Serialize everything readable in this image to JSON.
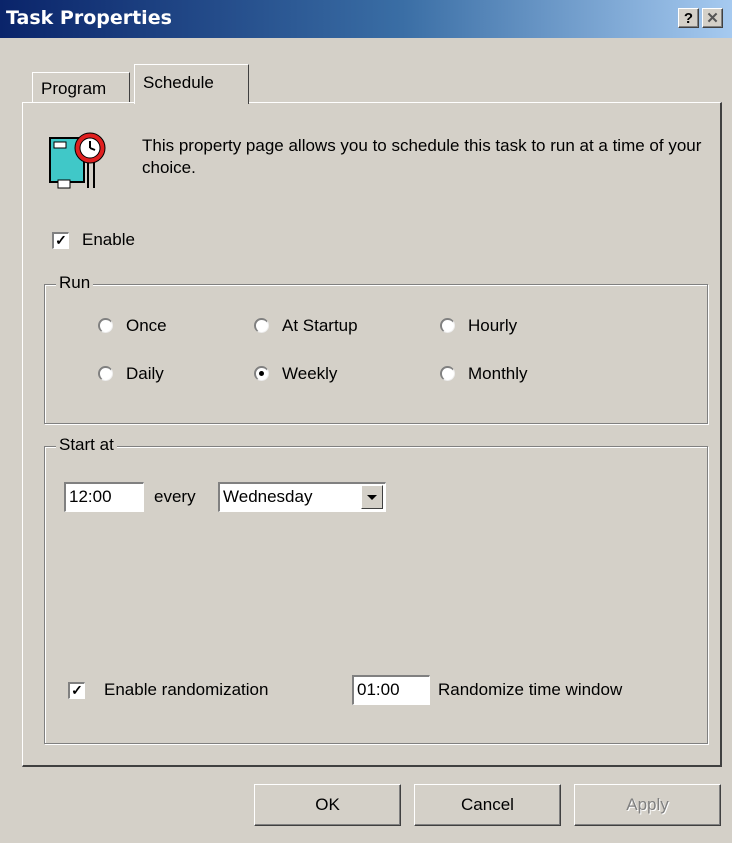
{
  "window": {
    "title": "Task Properties",
    "help_label": "?",
    "close_label": "✕"
  },
  "tabs": [
    {
      "label": "Program",
      "active": false
    },
    {
      "label": "Schedule",
      "active": true
    }
  ],
  "description": "This property page allows you to schedule this task to run at a time of your choice.",
  "enable": {
    "label": "Enable",
    "checked": true,
    "mark": "✓"
  },
  "run": {
    "title": "Run",
    "options": [
      {
        "label": "Once",
        "selected": false
      },
      {
        "label": "At Startup",
        "selected": false
      },
      {
        "label": "Hourly",
        "selected": false
      },
      {
        "label": "Daily",
        "selected": false
      },
      {
        "label": "Weekly",
        "selected": true
      },
      {
        "label": "Monthly",
        "selected": false
      }
    ]
  },
  "start_at": {
    "title": "Start at",
    "time": "12:00",
    "every_label": "every",
    "day": "Wednesday",
    "randomization": {
      "label": "Enable randomization",
      "checked": true,
      "mark": "✓"
    },
    "random_window_value": "01:00",
    "random_window_label": "Randomize time window"
  },
  "buttons": {
    "ok": "OK",
    "cancel": "Cancel",
    "apply": "Apply"
  },
  "colors": {
    "title_start": "#0a246a",
    "title_end": "#a6caf0",
    "face": "#d4d0c8"
  }
}
